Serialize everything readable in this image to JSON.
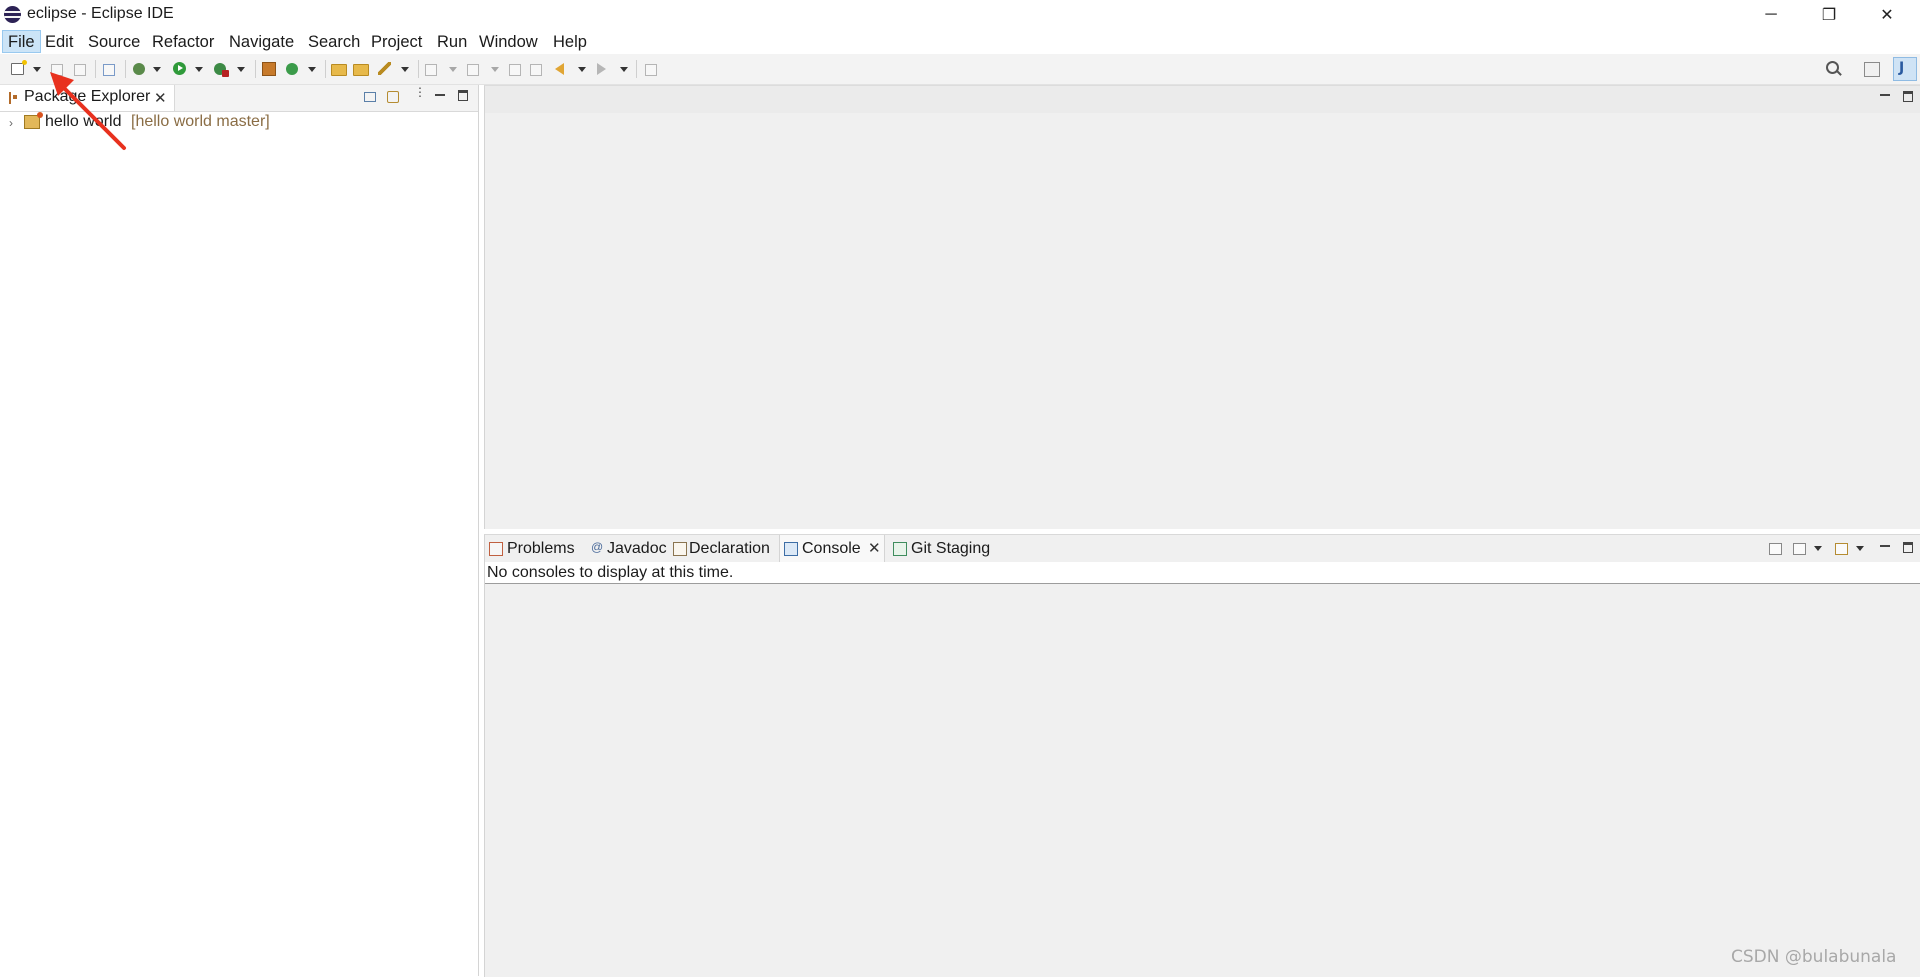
{
  "window": {
    "title": "eclipse - Eclipse IDE",
    "controls": {
      "minimize": "─",
      "restore": "❐",
      "close": "✕"
    }
  },
  "menu": {
    "items": [
      "File",
      "Edit",
      "Source",
      "Refactor",
      "Navigate",
      "Search",
      "Project",
      "Run",
      "Window",
      "Help"
    ],
    "active": "File"
  },
  "toolbar": {
    "icons": [
      "new-wizard-icon",
      "save-icon",
      "save-all-icon",
      "skip-breakpoints-icon",
      "debug-icon",
      "run-icon",
      "external-tools-icon",
      "new-java-package-icon",
      "new-java-class-icon",
      "open-type-icon",
      "open-task-icon",
      "search-icon",
      "next-annotation-icon",
      "prev-annotation-icon",
      "last-edit-location-icon",
      "back-icon",
      "forward-icon",
      "pin-editor-icon",
      "search-icon",
      "open-perspective-icon",
      "java-perspective-icon"
    ]
  },
  "package_explorer": {
    "tab_label": "Package Explorer",
    "close": "✕",
    "tree": [
      {
        "name": "hello world",
        "decoration": "[hello world master]"
      }
    ]
  },
  "bottom_panel": {
    "tabs": [
      {
        "label": "Problems",
        "icon": "problems-icon"
      },
      {
        "label": "Javadoc",
        "icon": "javadoc-icon"
      },
      {
        "label": "Declaration",
        "icon": "declaration-icon"
      },
      {
        "label": "Console",
        "icon": "console-icon",
        "active": true,
        "close": "✕"
      },
      {
        "label": "Git Staging",
        "icon": "git-staging-icon"
      }
    ],
    "console_message": "No consoles to display at this time."
  },
  "annotation": {
    "color": "#e8311e"
  },
  "watermark": "CSDN @bulabunala",
  "colors": {
    "menu_active_bg": "#cce4f7",
    "branch_decoration": "#8a6d45",
    "pane_bg": "#f0f0f0"
  }
}
